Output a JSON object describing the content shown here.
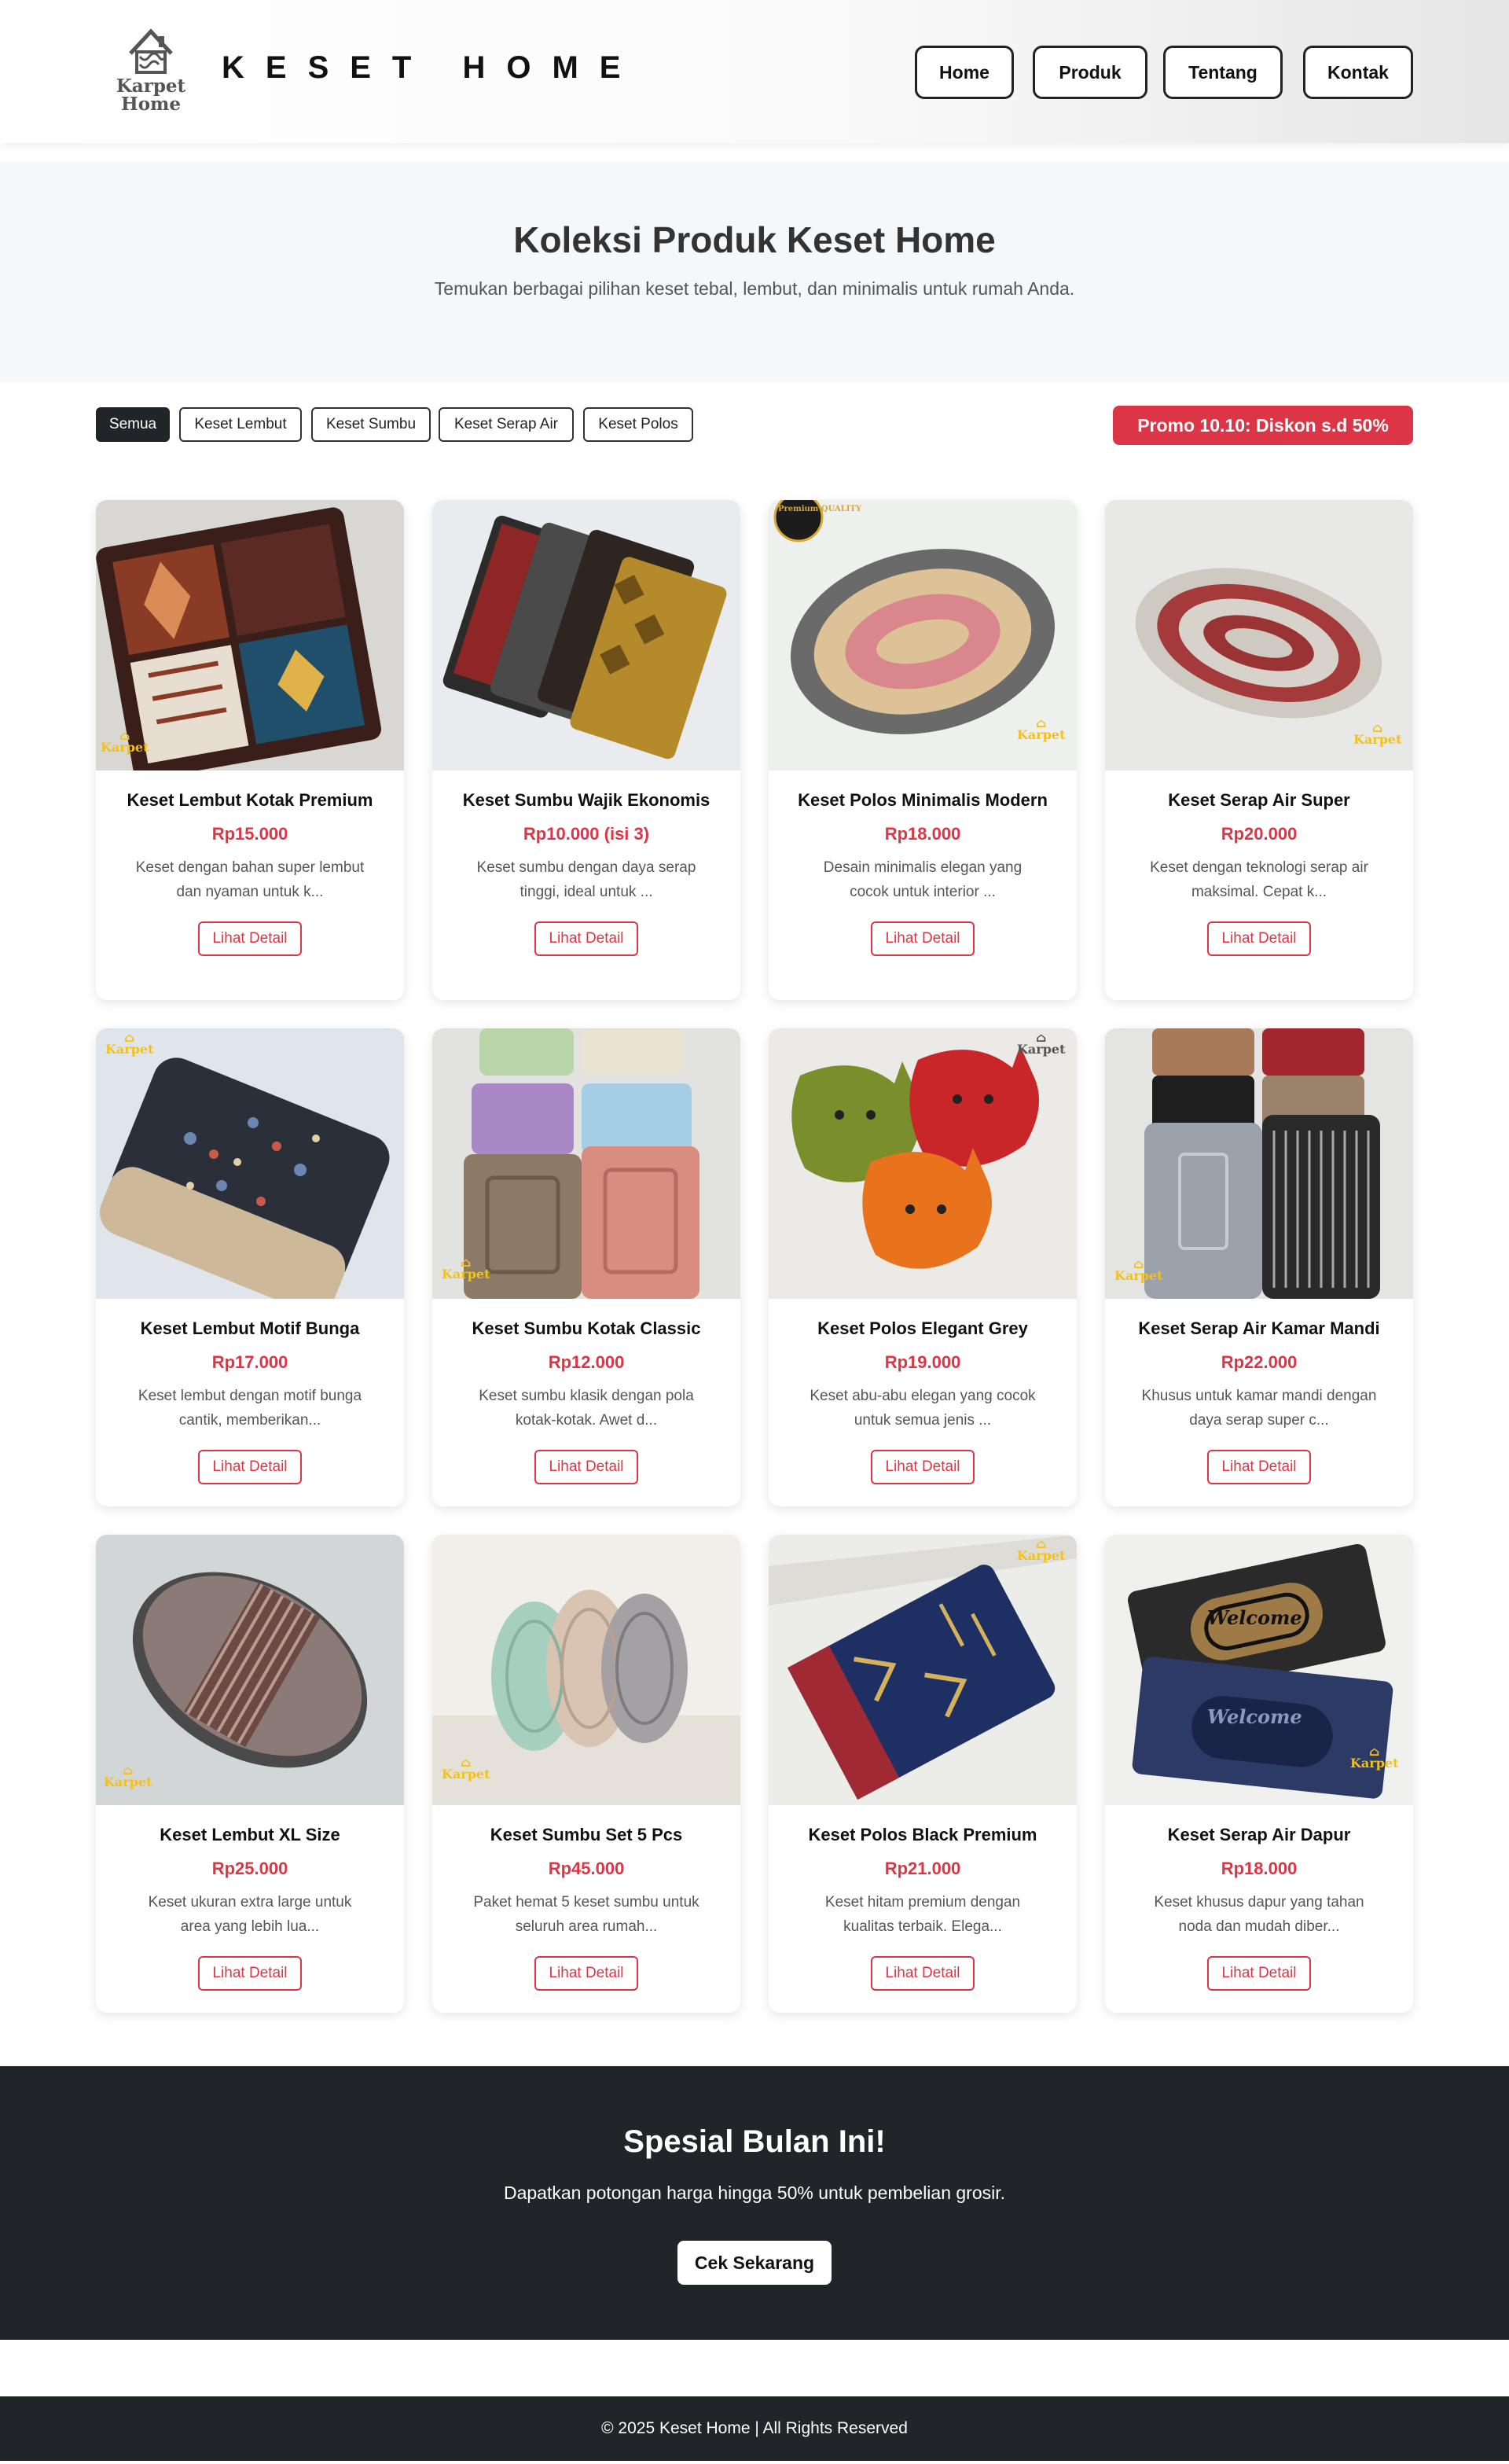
{
  "header": {
    "logo_line1": "Karpet",
    "logo_line2": "Home",
    "brand": "KESET HOME",
    "nav": [
      "Home",
      "Produk",
      "Tentang",
      "Kontak"
    ]
  },
  "hero": {
    "title": "Koleksi Produk Keset Home",
    "subtitle": "Temukan berbagai pilihan keset tebal, lembut, dan minimalis untuk rumah Anda."
  },
  "filters": {
    "chips": [
      "Semua",
      "Keset Lembut",
      "Keset Sumbu",
      "Keset Serap Air",
      "Keset Polos"
    ],
    "active": "Semua",
    "promo": "Promo 10.10: Diskon s.d 50%"
  },
  "products": [
    {
      "name": "Keset Lembut Kotak Premium",
      "price": "Rp15.000",
      "desc": "Keset dengan bahan super lembut dan nyaman untuk k...",
      "button": "Lihat Detail",
      "image": "patchwork-mat"
    },
    {
      "name": "Keset Sumbu Wajik Ekonomis",
      "price": "Rp10.000 (isi 3)",
      "desc": "Keset sumbu dengan daya serap tinggi, ideal untuk ...",
      "button": "Lihat Detail",
      "image": "stacked-mats"
    },
    {
      "name": "Keset Polos Minimalis Modern",
      "price": "Rp18.000",
      "desc": "Desain minimalis elegan yang cocok untuk interior ...",
      "button": "Lihat Detail",
      "image": "oval-braided-mat",
      "badge": "Premium QUALITY"
    },
    {
      "name": "Keset Serap Air Super",
      "price": "Rp20.000",
      "desc": "Keset dengan teknologi serap air maksimal. Cepat k...",
      "button": "Lihat Detail",
      "image": "oval-rope-mat"
    },
    {
      "name": "Keset Lembut Motif Bunga",
      "price": "Rp17.000",
      "desc": "Keset lembut dengan motif bunga cantik, memberikan...",
      "button": "Lihat Detail",
      "image": "rag-mat"
    },
    {
      "name": "Keset Sumbu Kotak Classic",
      "price": "Rp12.000",
      "desc": "Keset sumbu klasik dengan pola kotak-kotak. Awet d...",
      "button": "Lihat Detail",
      "image": "quilted-mats"
    },
    {
      "name": "Keset Polos Elegant Grey",
      "price": "Rp19.000",
      "desc": "Keset abu-abu elegan yang cocok untuk semua jenis ...",
      "button": "Lihat Detail",
      "image": "cat-mats"
    },
    {
      "name": "Keset Serap Air Kamar Mandi",
      "price": "Rp22.000",
      "desc": "Khusus untuk kamar mandi dengan daya serap super c...",
      "button": "Lihat Detail",
      "image": "bath-mats"
    },
    {
      "name": "Keset Lembut XL Size",
      "price": "Rp25.000",
      "desc": "Keset ukuran extra large untuk area yang lebih lua...",
      "button": "Lihat Detail",
      "image": "oval-stack"
    },
    {
      "name": "Keset Sumbu Set 5 Pcs",
      "price": "Rp45.000",
      "desc": "Paket hemat 5 keset sumbu untuk seluruh area rumah...",
      "button": "Lihat Detail",
      "image": "three-ovals"
    },
    {
      "name": "Keset Polos Black Premium",
      "price": "Rp21.000",
      "desc": "Keset hitam premium dengan kualitas terbaik. Elega...",
      "button": "Lihat Detail",
      "image": "navy-patterned-mat"
    },
    {
      "name": "Keset Serap Air Dapur",
      "price": "Rp18.000",
      "desc": "Keset khusus dapur yang tahan noda dan mudah diber...",
      "button": "Lihat Detail",
      "image": "welcome-mats",
      "mat_text": "Welcome"
    }
  ],
  "special": {
    "title": "Spesial Bulan Ini!",
    "text": "Dapatkan potongan harga hingga 50% untuk pembelian grosir.",
    "button": "Cek Sekarang"
  },
  "footer": {
    "text": "© 2025 Keset Home | All Rights Reserved"
  },
  "colors": {
    "accent": "#dc3545",
    "dark": "#212529",
    "hero_bg": "#f6f7f9",
    "watermark": "#f2c21a"
  }
}
